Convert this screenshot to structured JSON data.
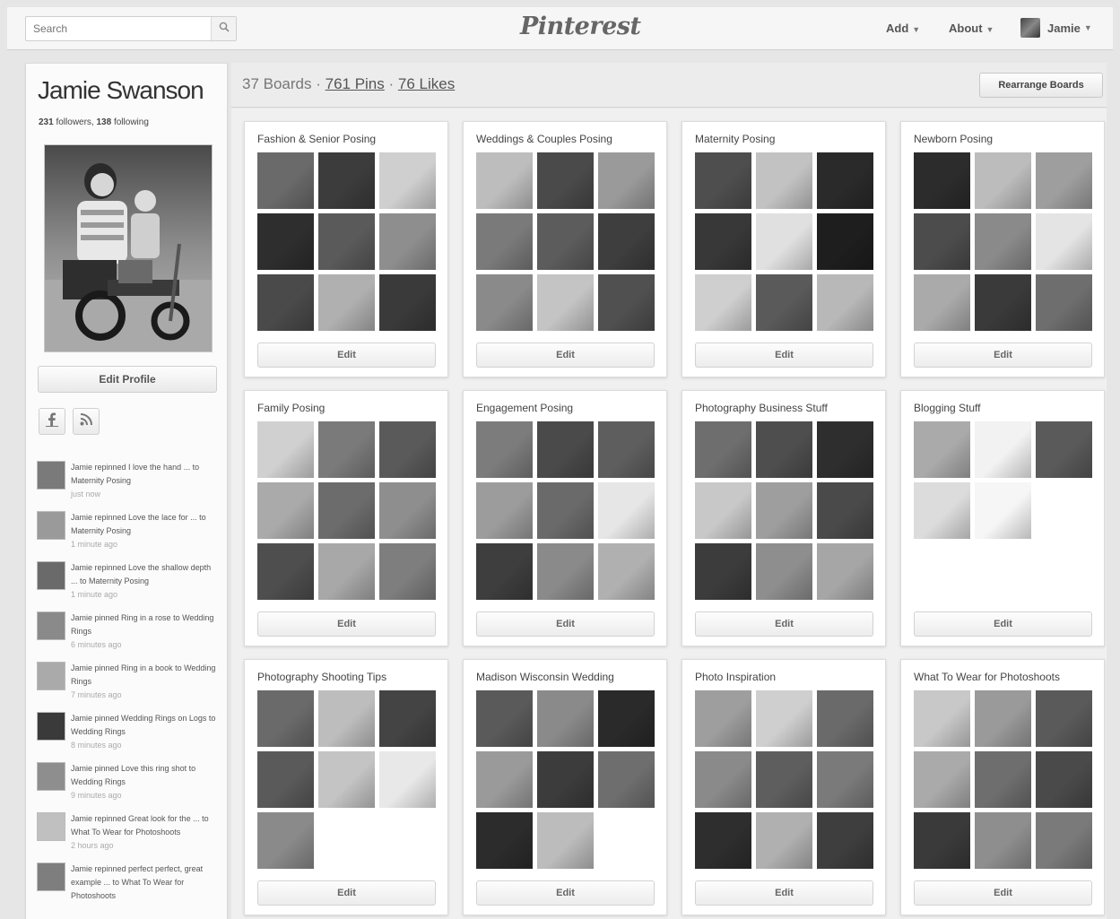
{
  "header": {
    "search_placeholder": "Search",
    "logo": "Pinterest",
    "nav": {
      "add": "Add",
      "about": "About",
      "user": "Jamie"
    }
  },
  "profile": {
    "name": "Jamie Swanson",
    "followers_count": "231",
    "followers_label": "followers,",
    "following_count": "138",
    "following_label": "following",
    "edit_profile": "Edit Profile"
  },
  "activity": [
    {
      "text": "Jamie repinned I love the hand ... to Maternity Posing",
      "time": "just now"
    },
    {
      "text": "Jamie repinned Love the lace for ... to Maternity Posing",
      "time": "1 minute ago"
    },
    {
      "text": "Jamie repinned Love the shallow depth ... to Maternity Posing",
      "time": "1 minute ago"
    },
    {
      "text": "Jamie pinned Ring in a rose to Wedding Rings",
      "time": "6 minutes ago"
    },
    {
      "text": "Jamie pinned Ring in a book to Wedding Rings",
      "time": "7 minutes ago"
    },
    {
      "text": "Jamie pinned Wedding Rings on Logs to Wedding Rings",
      "time": "8 minutes ago"
    },
    {
      "text": "Jamie pinned Love this ring shot to Wedding Rings",
      "time": "9 minutes ago"
    },
    {
      "text": "Jamie repinned Great look for the ... to What To Wear for Photoshoots",
      "time": "2 hours ago"
    },
    {
      "text": "Jamie repinned perfect perfect, great example ... to What To Wear for Photoshoots",
      "time": ""
    }
  ],
  "stats": {
    "boards": "37 Boards",
    "sep1": " · ",
    "pins": "761 Pins",
    "sep2": " · ",
    "likes": "76 Likes"
  },
  "rearrange_label": "Rearrange Boards",
  "edit_label": "Edit",
  "boards": [
    {
      "title": "Fashion & Senior Posing",
      "tones": [
        "#6a6a6a",
        "#3c3c3c",
        "#cfcfcf",
        "#2e2e2e",
        "#5a5a5a",
        "#8e8e8e",
        "#4a4a4a",
        "#b0b0b0",
        "#3a3a3a"
      ]
    },
    {
      "title": "Weddings & Couples Posing",
      "tones": [
        "#bdbdbd",
        "#4a4a4a",
        "#9a9a9a",
        "#7a7a7a",
        "#5c5c5c",
        "#3e3e3e",
        "#8a8a8a",
        "#c4c4c4",
        "#505050"
      ]
    },
    {
      "title": "Maternity Posing",
      "tones": [
        "#4e4e4e",
        "#c2c2c2",
        "#2a2a2a",
        "#383838",
        "#e0e0e0",
        "#1e1e1e",
        "#cfcfcf",
        "#5a5a5a",
        "#b8b8b8"
      ]
    },
    {
      "title": "Newborn Posing",
      "tones": [
        "#2c2c2c",
        "#bcbcbc",
        "#9e9e9e",
        "#4c4c4c",
        "#8a8a8a",
        "#e4e4e4",
        "#aaaaaa",
        "#3a3a3a",
        "#6e6e6e"
      ]
    },
    {
      "title": "Family Posing",
      "tones": [
        "#d0d0d0",
        "#7a7a7a",
        "#5a5a5a",
        "#aaaaaa",
        "#6c6c6c",
        "#8e8e8e",
        "#4e4e4e",
        "#a8a8a8",
        "#7e7e7e"
      ]
    },
    {
      "title": "Engagement Posing",
      "tones": [
        "#7c7c7c",
        "#4a4a4a",
        "#5e5e5e",
        "#9c9c9c",
        "#6a6a6a",
        "#e6e6e6",
        "#3e3e3e",
        "#8a8a8a",
        "#b0b0b0"
      ]
    },
    {
      "title": "Photography Business Stuff",
      "tones": [
        "#6e6e6e",
        "#4e4e4e",
        "#2e2e2e",
        "#c8c8c8",
        "#9e9e9e",
        "#4a4a4a",
        "#3c3c3c",
        "#8e8e8e",
        "#a6a6a6"
      ]
    },
    {
      "title": "Blogging Stuff",
      "tones": [
        "#aaaaaa",
        "#f2f2f2",
        "#5a5a5a",
        "#dcdcdc",
        "#f6f6f6",
        "",
        "",
        "",
        ""
      ]
    },
    {
      "title": "Photography Shooting Tips",
      "tones": [
        "#6a6a6a",
        "#bdbdbd",
        "#444444",
        "#5a5a5a",
        "#c4c4c4",
        "#e8e8e8",
        "#8a8a8a",
        "",
        ""
      ]
    },
    {
      "title": "Madison Wisconsin Wedding",
      "tones": [
        "#5a5a5a",
        "#8a8a8a",
        "#2a2a2a",
        "#9a9a9a",
        "#3c3c3c",
        "#6e6e6e",
        "#2c2c2c",
        "#bcbcbc",
        ""
      ]
    },
    {
      "title": "Photo Inspiration",
      "tones": [
        "#9e9e9e",
        "#cfcfcf",
        "#6a6a6a",
        "#8a8a8a",
        "#5e5e5e",
        "#7a7a7a",
        "#2e2e2e",
        "#b0b0b0",
        "#3e3e3e"
      ]
    },
    {
      "title": "What To Wear for Photoshoots",
      "tones": [
        "#c8c8c8",
        "#9a9a9a",
        "#5a5a5a",
        "#aaaaaa",
        "#6e6e6e",
        "#4a4a4a",
        "#3a3a3a",
        "#8e8e8e",
        "#7a7a7a"
      ]
    }
  ]
}
